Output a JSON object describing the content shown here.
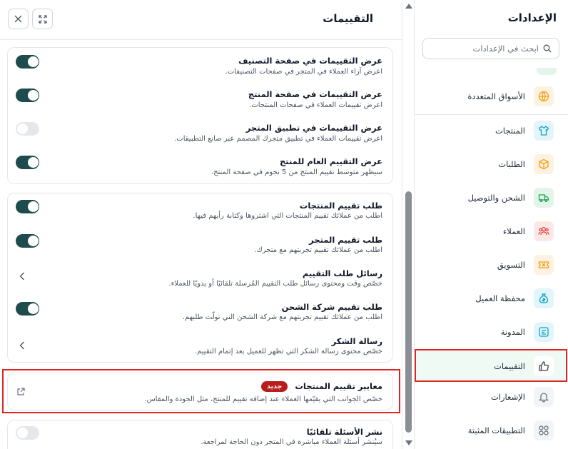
{
  "sidebar": {
    "title": "الإعدادات",
    "search_placeholder": "ابحث في الإعدادات",
    "items": [
      {
        "label": "الأسواق المتعددة",
        "icon": "globe-icon",
        "color": "#f59e0b",
        "bg": "#fdf1e1"
      },
      {
        "label": "المنتجات",
        "icon": "tshirt-icon",
        "color": "#0ea5c6",
        "bg": "#e2f5fa"
      },
      {
        "label": "الطلبات",
        "icon": "box-icon",
        "color": "#f59e0b",
        "bg": "#fdf1e1"
      },
      {
        "label": "الشحن والتوصيل",
        "icon": "truck-icon",
        "color": "#22a35a",
        "bg": "#e3f5ea"
      },
      {
        "label": "العملاء",
        "icon": "users-icon",
        "color": "#ef4444",
        "bg": "#fde8e8"
      },
      {
        "label": "التسويق",
        "icon": "ticket-icon",
        "color": "#f59e0b",
        "bg": "#fdf1e1"
      },
      {
        "label": "محفظة العميل",
        "icon": "money-bag-icon",
        "color": "#0ea5c6",
        "bg": "#e2f5fa"
      },
      {
        "label": "المدونة",
        "icon": "blog-icon",
        "color": "#0ea5c6",
        "bg": "#e2f5fa"
      },
      {
        "label": "التقييمات",
        "icon": "thumbs-up-icon",
        "color": "#374151",
        "bg": "#ffffff",
        "active": true
      },
      {
        "label": "الإشعارات",
        "icon": "bell-icon",
        "color": "#6b7280",
        "bg": "#f3f4f6"
      },
      {
        "label": "التطبيقات المثبتة",
        "icon": "apps-grid-icon",
        "color": "#6b7280",
        "bg": "#f3f4f6"
      }
    ]
  },
  "main": {
    "title": "التقييمات",
    "cards": [
      {
        "rows": [
          {
            "title": "عرض التقييمات في صفحة التصنيف",
            "desc": "اعرض آراء العملاء في المتجر في صفحات التصنيفات.",
            "control": "toggle",
            "on": true
          },
          {
            "title": "عرض التقييمات في صفحة المنتج",
            "desc": "اعرض تقييمات العملاء في صفحات المنتجات.",
            "control": "toggle",
            "on": true
          },
          {
            "title": "عرض التقييمات في تطبيق المتجر",
            "desc": "اعرض تقييمات العملاء في تطبيق متجرك المصمم عبر صانع التطبيقات.",
            "control": "toggle",
            "on": false
          },
          {
            "title": "عرض التقييم العام للمنتج",
            "desc": "سيظهر متوسط تقييم المنتج من 5 نجوم في صفحة المنتج.",
            "control": "toggle",
            "on": true
          }
        ]
      },
      {
        "rows": [
          {
            "title": "طلب تقييم المنتجات",
            "desc": "اطلب من عملائك تقييم المنتجات التي اشتروها وكتابة رأيهم فيها.",
            "control": "toggle",
            "on": true
          },
          {
            "title": "طلب تقييم المتجر",
            "desc": "اطلب من عملائك تقييم تجربتهم مع متجرك.",
            "control": "toggle",
            "on": true
          },
          {
            "title": "رسائل طلب التقييم",
            "desc": "خصّص وقت ومحتوى رسائل طلب التقييم المُرسلة تلقائيًا أو يدويًا للعملاء.",
            "control": "chevron"
          },
          {
            "title": "طلب تقييم شركة الشحن",
            "desc": "اطلب من عملائك تقييم تجربتهم مع شركة الشحن التي تولّت طلبهم.",
            "control": "toggle",
            "on": true
          },
          {
            "title": "رسالة الشكر",
            "desc": "خصّص محتوى رسالة الشكر التي تظهر للعميل بعد إتمام التقييم.",
            "control": "chevron"
          }
        ]
      },
      {
        "rows": [
          {
            "title": "معايير تقييم المنتجات",
            "badge": "جديد",
            "desc": "خصّص الجوانب التي يقيّمها العملاء عند إضافة تقييم للمنتج، مثل الجودة والمقاس.",
            "control": "external-link"
          }
        ]
      },
      {
        "rows": [
          {
            "title": "نشر الأسئلة تلقائيًا",
            "desc": "سيُنشر أسئلة العملاء مباشرة في المتجر دون الحاجة لمراجعة.",
            "control": "toggle",
            "on": false
          }
        ]
      }
    ]
  },
  "colors": {
    "toggle_on": "#1e4c4c",
    "toggle_off": "#e5e7eb",
    "badge": "#b91c1c",
    "highlight": "#dc2626",
    "active_bg": "#eefaf3"
  }
}
